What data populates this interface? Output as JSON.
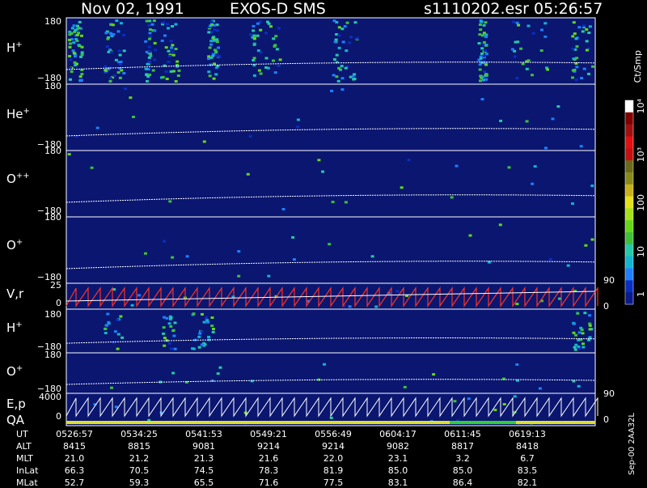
{
  "title": {
    "date": "Nov 02, 1991",
    "instrument": "EXOS-D SMS",
    "file": "s1110202.esr",
    "time": "05:26:57"
  },
  "colorbar": {
    "unit_label": "Ct/Smp",
    "ticks": [
      "1",
      "10",
      "100",
      "10³",
      "10⁴"
    ],
    "colors": [
      "#0b1a8c",
      "#0a2ec0",
      "#1f7fff",
      "#12b4d0",
      "#25c9a8",
      "#3fbf3a",
      "#65d61a",
      "#a5e01a",
      "#e4e01a",
      "#c8b01a",
      "#8a8a1a",
      "#6a6a1a",
      "#c41010",
      "#e01010",
      "#a01010",
      "#800000",
      "#ffffff"
    ]
  },
  "panels": [
    {
      "id": "h-plus-1",
      "label": "H",
      "sup": "+",
      "top_tick": "180",
      "bottom_tick": "−180"
    },
    {
      "id": "he-plus",
      "label": "He",
      "sup": "+",
      "top_tick": "180",
      "bottom_tick": "−180"
    },
    {
      "id": "o-plusplus",
      "label": "O",
      "sup": "++",
      "top_tick": "180",
      "bottom_tick": "−180"
    },
    {
      "id": "o-plus-1",
      "label": "O",
      "sup": "+",
      "top_tick": "180",
      "bottom_tick": "−180",
      "right_tick": "90"
    },
    {
      "id": "vr",
      "label": "V,r",
      "sup": "",
      "top_tick": "25",
      "bottom_tick": "0",
      "right_tick": "0"
    },
    {
      "id": "h-plus-2",
      "label": "H",
      "sup": "+",
      "top_tick": "180",
      "bottom_tick": "−180"
    },
    {
      "id": "o-plus-2",
      "label": "O",
      "sup": "+",
      "top_tick": "180",
      "bottom_tick": "−180",
      "right_tick": "90"
    },
    {
      "id": "ep-qa",
      "label": "E,p",
      "label2": "QA",
      "sup": "",
      "top_tick": "4000",
      "bottom_tick": "0",
      "right_tick": "0"
    }
  ],
  "time_axis": {
    "rows": [
      {
        "name": "UT",
        "values": [
          "0526:57",
          "0534:25",
          "0541:53",
          "0549:21",
          "0556:49",
          "0604:17",
          "0611:45",
          "0619:13"
        ]
      },
      {
        "name": "ALT",
        "values": [
          "8415",
          "8815",
          "9081",
          "9214",
          "9214",
          "9082",
          "8817",
          "8418"
        ]
      },
      {
        "name": "MLT",
        "values": [
          "21.0",
          "21.2",
          "21.3",
          "21.6",
          "22.0",
          "23.1",
          "3.2",
          "6.7"
        ]
      },
      {
        "name": "InLat",
        "values": [
          "66.3",
          "70.5",
          "74.5",
          "78.3",
          "81.9",
          "85.0",
          "85.0",
          "83.5"
        ]
      },
      {
        "name": "MLat",
        "values": [
          "52.7",
          "59.3",
          "65.5",
          "71.6",
          "77.5",
          "83.1",
          "86.4",
          "82.1"
        ]
      }
    ]
  },
  "footer_stamp": "Sep-00 2AA32L",
  "chart_data": {
    "type": "heatmap",
    "title": "Nov 02, 1991 EXOS-D SMS s1110202.esr 05:26:57",
    "x_ticks": [
      "0526:57",
      "0534:25",
      "0541:53",
      "0549:21",
      "0556:49",
      "0604:17",
      "0611:45",
      "0619:13"
    ],
    "panels": [
      "H+",
      "He+",
      "O++",
      "O+",
      "V,r",
      "H+",
      "O+",
      "E,p QA"
    ],
    "pitch_angle_range": [
      -180,
      180
    ],
    "vr_range": [
      0,
      25
    ],
    "ep_range": [
      0,
      4000
    ],
    "colorbar_range": [
      1,
      10000
    ],
    "colorbar_scale": "log",
    "colorbar_label": "Ct/Smp"
  }
}
